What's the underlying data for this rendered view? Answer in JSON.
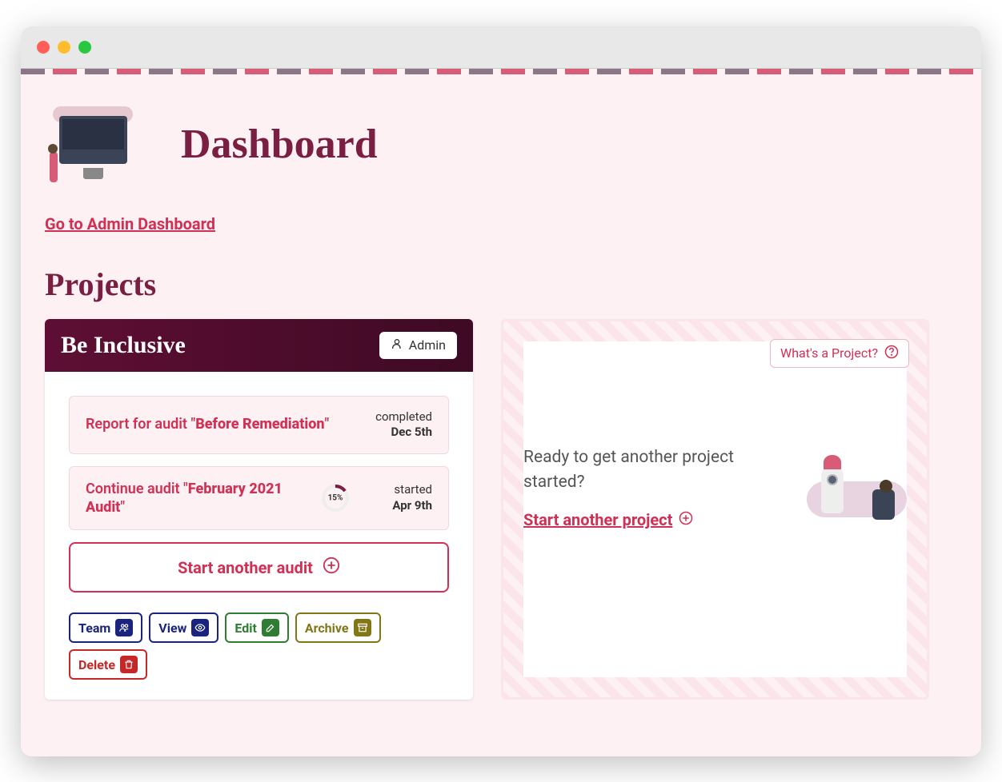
{
  "page": {
    "title": "Dashboard",
    "admin_link": "Go to Admin Dashboard",
    "section_title": "Projects"
  },
  "project": {
    "name": "Be Inclusive",
    "badge_label": "Admin",
    "audits": [
      {
        "prefix": "Report for audit \"",
        "name": "Before Remediation",
        "suffix": "\"",
        "status_label": "completed",
        "date": "Dec 5th"
      },
      {
        "prefix": "Continue audit \"",
        "name": "February 2021 Audit",
        "suffix": "\"",
        "status_label": "started",
        "date": "Apr 9th",
        "progress": "15%"
      }
    ],
    "start_audit_label": "Start another audit",
    "actions": {
      "team": "Team",
      "view": "View",
      "edit": "Edit",
      "archive": "Archive",
      "delete": "Delete"
    }
  },
  "new_project": {
    "whats_label": "What's a Project?",
    "prompt": "Ready to get another project started?",
    "link_label": "Start another project"
  }
}
